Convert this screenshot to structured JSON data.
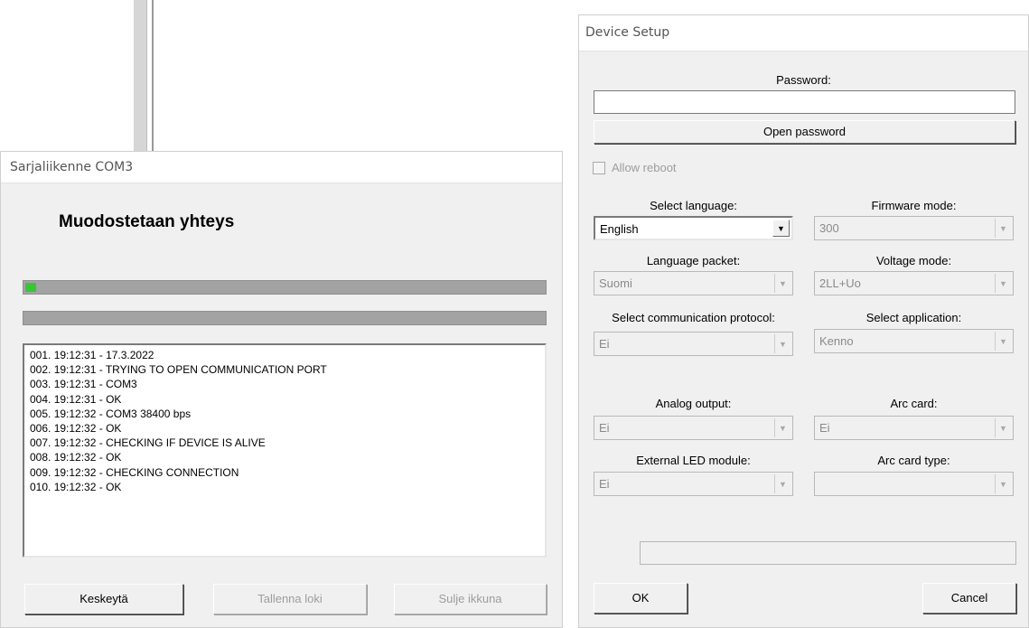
{
  "serial": {
    "title": "Sarjaliikenne COM3",
    "heading": "Muodostetaan yhteys",
    "progress": 0.02,
    "log": [
      "001. 19:12:31 - 17.3.2022",
      "002. 19:12:31 - TRYING TO OPEN COMMUNICATION PORT",
      "003. 19:12:31 - COM3",
      "004. 19:12:31 - OK",
      "005. 19:12:32 - COM3 38400 bps",
      "006. 19:12:32 - OK",
      "007. 19:12:32 - CHECKING IF DEVICE IS ALIVE",
      "008. 19:12:32 - OK",
      "009. 19:12:32 - CHECKING CONNECTION",
      "010. 19:12:32 - OK"
    ],
    "buttons": {
      "abort": "Keskeytä",
      "save_log": "Tallenna loki",
      "close": "Sulje ikkuna"
    }
  },
  "setup": {
    "title": "Device Setup",
    "password_label": "Password:",
    "password_value": "",
    "open_password": "Open password",
    "allow_reboot": "Allow reboot",
    "fields": {
      "select_language": {
        "label": "Select language:",
        "value": "English"
      },
      "firmware_mode": {
        "label": "Firmware mode:",
        "value": "300"
      },
      "language_packet": {
        "label": "Language packet:",
        "value": "Suomi"
      },
      "voltage_mode": {
        "label": "Voltage mode:",
        "value": "2LL+Uo"
      },
      "comm_protocol": {
        "label": "Select communication protocol:",
        "value": "Ei"
      },
      "application": {
        "label": "Select application:",
        "value": "Kenno"
      },
      "analog_output": {
        "label": "Analog output:",
        "value": "Ei"
      },
      "arc_card": {
        "label": "Arc card:",
        "value": "Ei"
      },
      "external_led": {
        "label": "External LED module:",
        "value": "Ei"
      },
      "arc_card_type": {
        "label": "Arc card type:",
        "value": ""
      }
    },
    "ok": "OK",
    "cancel": "Cancel"
  }
}
